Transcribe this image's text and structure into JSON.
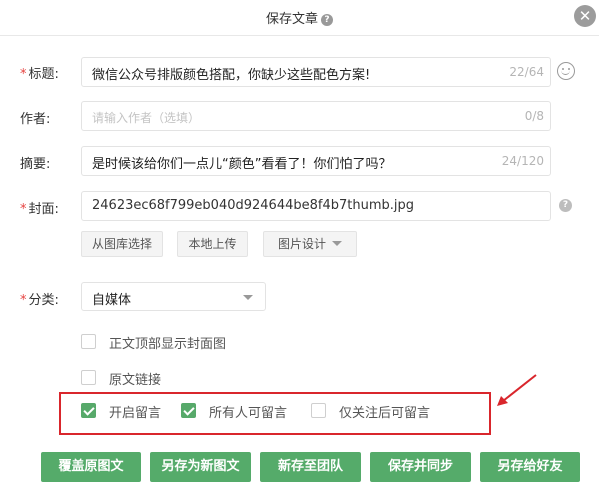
{
  "dialog": {
    "title": "保存文章"
  },
  "form": {
    "title_label": "标题:",
    "title_value": "微信公众号排版颜色搭配，你缺少这些配色方案!",
    "title_counter": "22/64",
    "author_label": "作者:",
    "author_placeholder": "请输入作者（选填）",
    "author_counter": "0/8",
    "summary_label": "摘要:",
    "summary_value": "是时候该给你们一点儿“颜色”看看了！你们怕了吗？",
    "summary_counter": "24/120",
    "cover_label": "封面:",
    "cover_value": "24623ec68f799eb040d924644be8f4b7thumb.jpg",
    "cover_buttons": {
      "from_library": "从图库选择",
      "local_upload": "本地上传",
      "image_design": "图片设计"
    },
    "category_label": "分类:",
    "category_value": "自媒体"
  },
  "options": [
    {
      "label": "正文顶部显示封面图",
      "checked": false
    },
    {
      "label": "原文链接",
      "checked": false
    },
    {
      "label": "开启留言",
      "checked": true
    },
    {
      "label": "所有人可留言",
      "checked": true
    },
    {
      "label": "仅关注后可留言",
      "checked": false
    }
  ],
  "actions": {
    "overwrite": "覆盖原图文",
    "save_as_new": "另存为新图文",
    "save_to_team": "新存至团队",
    "save_and_sync": "保存并同步",
    "save_to_friend": "另存给好友"
  },
  "colors": {
    "accent_green": "#55ab6a",
    "highlight_red": "#d9262c",
    "required_star": "#e64340"
  },
  "icons": {
    "close": "close-icon",
    "help": "help-icon",
    "emoji": "emoji-icon",
    "dropdown": "chevron-down-icon"
  }
}
